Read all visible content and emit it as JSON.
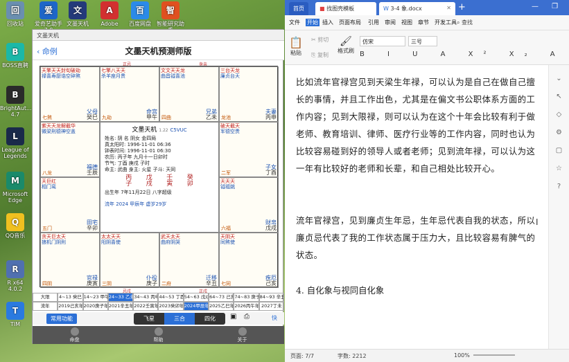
{
  "desktop": {
    "icons": [
      {
        "label": "回收站",
        "color": "#6a8fb0"
      },
      {
        "label": "爱奇艺助手7.0",
        "color": "#1e66c8"
      },
      {
        "label": "文墨天机",
        "color": "#243a7a"
      },
      {
        "label": "Adobe",
        "color": "#d23030"
      },
      {
        "label": "百度网盘",
        "color": "#2b8ae8"
      },
      {
        "label": "智能研究助手",
        "color": "#e05020"
      },
      {
        "label": "BOSS直聘",
        "color": "#1bb8a8"
      },
      {
        "label": "BrightAut... 4.7",
        "color": "#2a2a2a"
      },
      {
        "label": "League of Legends",
        "color": "#1a2a4a"
      },
      {
        "label": "Microsoft Edge",
        "color": "#1a8a6a"
      },
      {
        "label": "QQ音乐",
        "color": "#f0c020"
      },
      {
        "label": "R x64 4.0.2",
        "color": "#5070b0"
      },
      {
        "label": "TIM",
        "color": "#2a7ae0"
      }
    ]
  },
  "app": {
    "window_title": "文墨天机",
    "nav_back": "命例",
    "title": "文墨天机预测师版",
    "top_labels": [
      "正忌",
      "身亲"
    ],
    "palaces": [
      {
        "stars": "天擎天天封旬破劫",
        "stars2": "禄喜寿厨诰空碎煞",
        "palace": "父母",
        "branch": "癸巳",
        "phase": "七煞"
      },
      {
        "stars": "七擎八天天",
        "stars2": "杀羊座月贵",
        "palace": "命宫",
        "branch": "甲午",
        "phase": "九劫"
      },
      {
        "stars": "文文天天龙",
        "stars2": "曲昌钺喜池",
        "palace": "兄弟",
        "branch": "乙未",
        "phase": "四曲"
      },
      {
        "stars": "三台天龙",
        "stars2": "廉贞台天",
        "palace": "夫妻",
        "branch": "丙申",
        "phase": "龙池"
      },
      {
        "stars": "紫天天龙解截华",
        "stars2": "微梁刑德神空盖",
        "palace": "福德",
        "branch": "壬辰",
        "phase": "八龙"
      },
      {
        "stars": "破天截天",
        "stars2": "军德空贵",
        "palace": "子女",
        "branch": "丁酉",
        "phase": "二军"
      },
      {
        "stars": "天巨红",
        "stars2": "相门鸾",
        "palace": "田宅",
        "branch": "辛卯",
        "phase": "五门"
      },
      {
        "stars": "天天天",
        "stars2": "钺福姚",
        "palace": "财帛",
        "branch": "戊戌",
        "phase": "六福"
      },
      {
        "stars": "贪天巨太天",
        "stars2": "狼机门阴刑",
        "palace": "官禄",
        "branch": "庚寅",
        "phase": "四阴"
      },
      {
        "stars": "太太天天",
        "stars2": "阳阴喜使",
        "palace": "仆役",
        "branch": "庚子",
        "phase": "三阴"
      },
      {
        "stars": "武天太天",
        "stars2": "曲府阴哭",
        "palace": "迁移",
        "branch": "辛丑",
        "phase": "二府"
      },
      {
        "stars": "天阴天",
        "stars2": "同煞使",
        "palace": "疾厄",
        "branch": "己亥",
        "phase": "七同"
      }
    ],
    "center": {
      "title": "文墨天机",
      "version": "1.22",
      "code": "C5VUC",
      "lines": [
        "姓名: 阴 名    阴女 金四局",
        "真太阳时: 1996-11-01 06:36",
        "钟表时间: 1996-11-01 06:30",
        "农历: 丙子年 九月十一日卯时",
        "节气: 丁酉 庚戌 子时",
        "命主: 武曲 身主: 火星 子斗: 天同"
      ],
      "pillars": [
        "丙",
        "戊",
        "壬",
        "癸"
      ],
      "pillars2": [
        "子",
        "戌",
        "寅",
        "卯"
      ],
      "bazi_label": "出生年 7年11月22日 八字超级",
      "year_line": "流年 2024 甲辰年 虚岁29岁"
    },
    "bottom_labels": [
      "忌戌",
      "正戌"
    ],
    "decades": [
      "大限",
      "4~13 癸巳",
      "14~23 甲午",
      "24~33 乙未",
      "34~43 丙申",
      "44~53 丁酉",
      "54~63 戊戌",
      "64~73 己亥",
      "74~83 庚子",
      "84~93 辛丑"
    ],
    "years": [
      "流年",
      "2019己亥年",
      "2020庚子年",
      "2021辛丑年",
      "2022壬寅年",
      "2023癸卯年",
      "2024甲辰年",
      "2025乙巳年",
      "2026丙午年",
      "2027丁未"
    ],
    "functions": "常用功能",
    "seg": [
      "飞星",
      "三合",
      "四化"
    ],
    "seg_right": "快",
    "tabs": [
      "命盘",
      "帮助",
      "关于"
    ]
  },
  "word": {
    "tabs": [
      "首页",
      "找图壳模板",
      "3-4 象.docx"
    ],
    "menu": [
      "文件",
      "开始",
      "插入",
      "页面布局",
      "引用",
      "审阅",
      "视图",
      "章节",
      "开发工具"
    ],
    "search": "查找",
    "ribbon": {
      "paste": "粘贴",
      "cut": "剪切",
      "copy": "复制",
      "format": "格式刷",
      "font": "仿宋",
      "size": "三号"
    },
    "paragraphs": [
      "比如流年官禄宫见到天梁生年禄，可以认为是自己在做自己擅长的事情，并且工作出色，尤其是在偏文书公职体系方面的工作内容；见到大限禄，则可以认为在这个十年会比较有利于做老师、教育培训、律师、医疗行业等的工作内容，同时也认为比较容易碰到好的领导人或者老师；见到流年禄，可以认为这一年有比较好的老师和长辈，和自己相处比较开心。",
      "流年官禄宫，见到廉贞生年忌，生年忌代表自我的状态，所以廉贞忌代表了我的工作状态属于压力大，且比较容易有脾气的状态。"
    ],
    "heading": "4.  自化象与视同自化象",
    "status": {
      "page": "页面: 7/7",
      "words": "字数: 2212",
      "zoom": "100%"
    }
  }
}
